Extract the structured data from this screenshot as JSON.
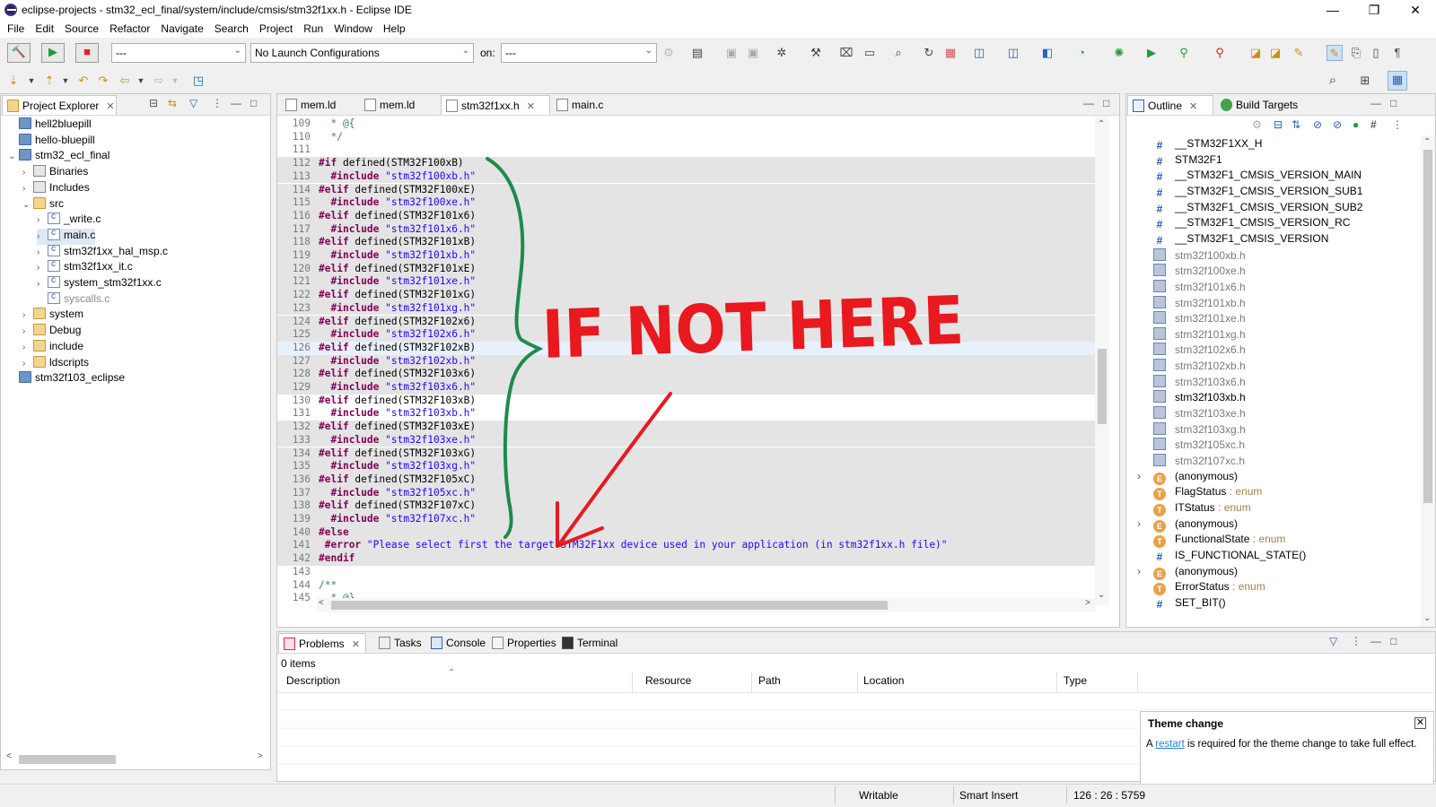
{
  "window": {
    "title": "eclipse-projects - stm32_ecl_final/system/include/cmsis/stm32f1xx.h - Eclipse IDE",
    "minimize": "—",
    "restore": "❐",
    "close": "✕"
  },
  "menu": [
    "File",
    "Edit",
    "Source",
    "Refactor",
    "Navigate",
    "Search",
    "Project",
    "Run",
    "Window",
    "Help"
  ],
  "toolbar": {
    "mode_combo": "---",
    "launch_combo": "No Launch Configurations",
    "on_label": "on:",
    "target_combo": "---"
  },
  "project_explorer": {
    "tab_label": "Project Explorer",
    "items": [
      {
        "label": "hell2bluepill",
        "icon": "project",
        "depth": 0,
        "twisty": ""
      },
      {
        "label": "hello-bluepill",
        "icon": "project",
        "depth": 0,
        "twisty": ""
      },
      {
        "label": "stm32_ecl_final",
        "icon": "project",
        "depth": 0,
        "twisty": "v"
      },
      {
        "label": "Binaries",
        "icon": "bin",
        "depth": 1,
        "twisty": ">"
      },
      {
        "label": "Includes",
        "icon": "inc",
        "depth": 1,
        "twisty": ">"
      },
      {
        "label": "src",
        "icon": "folder",
        "depth": 1,
        "twisty": "v"
      },
      {
        "label": "_write.c",
        "icon": "cfile",
        "depth": 2,
        "twisty": ">"
      },
      {
        "label": "main.c",
        "icon": "cfile",
        "depth": 2,
        "twisty": ">"
      },
      {
        "label": "stm32f1xx_hal_msp.c",
        "icon": "cfile",
        "depth": 2,
        "twisty": ">"
      },
      {
        "label": "stm32f1xx_it.c",
        "icon": "cfile",
        "depth": 2,
        "twisty": ">"
      },
      {
        "label": "system_stm32f1xx.c",
        "icon": "cfile",
        "depth": 2,
        "twisty": ">"
      },
      {
        "label": "syscalls.c",
        "icon": "cfile",
        "depth": 2,
        "twisty": ""
      },
      {
        "label": "system",
        "icon": "folder",
        "depth": 1,
        "twisty": ">"
      },
      {
        "label": "Debug",
        "icon": "folder",
        "depth": 1,
        "twisty": ">"
      },
      {
        "label": "include",
        "icon": "folder",
        "depth": 1,
        "twisty": ">"
      },
      {
        "label": "ldscripts",
        "icon": "folder",
        "depth": 1,
        "twisty": ">"
      },
      {
        "label": "stm32f103_eclipse",
        "icon": "project",
        "depth": 0,
        "twisty": ""
      }
    ]
  },
  "editor": {
    "tabs": [
      "mem.ld",
      "mem.ld",
      "stm32f1xx.h",
      "main.c"
    ],
    "active_tab": 2,
    "lines": [
      {
        "n": "109",
        "text": "  * @{"
      },
      {
        "n": "110",
        "text": "  */"
      },
      {
        "n": "111",
        "text": ""
      },
      {
        "n": "112",
        "text": "#if defined(STM32F100xB)"
      },
      {
        "n": "113",
        "text": "  #include \"stm32f100xb.h\""
      },
      {
        "n": "114",
        "text": "#elif defined(STM32F100xE)"
      },
      {
        "n": "115",
        "text": "  #include \"stm32f100xe.h\""
      },
      {
        "n": "116",
        "text": "#elif defined(STM32F101x6)"
      },
      {
        "n": "117",
        "text": "  #include \"stm32f101x6.h\""
      },
      {
        "n": "118",
        "text": "#elif defined(STM32F101xB)"
      },
      {
        "n": "119",
        "text": "  #include \"stm32f101xb.h\""
      },
      {
        "n": "120",
        "text": "#elif defined(STM32F101xE)"
      },
      {
        "n": "121",
        "text": "  #include \"stm32f101xe.h\""
      },
      {
        "n": "122",
        "text": "#elif defined(STM32F101xG)"
      },
      {
        "n": "123",
        "text": "  #include \"stm32f101xg.h\""
      },
      {
        "n": "124",
        "text": "#elif defined(STM32F102x6)"
      },
      {
        "n": "125",
        "text": "  #include \"stm32f102x6.h\""
      },
      {
        "n": "126",
        "text": "#elif defined(STM32F102xB)"
      },
      {
        "n": "127",
        "text": "  #include \"stm32f102xb.h\""
      },
      {
        "n": "128",
        "text": "#elif defined(STM32F103x6)"
      },
      {
        "n": "129",
        "text": "  #include \"stm32f103x6.h\""
      },
      {
        "n": "130",
        "text": "#elif defined(STM32F103xB)"
      },
      {
        "n": "131",
        "text": "  #include \"stm32f103xb.h\""
      },
      {
        "n": "132",
        "text": "#elif defined(STM32F103xE)"
      },
      {
        "n": "133",
        "text": "  #include \"stm32f103xe.h\""
      },
      {
        "n": "134",
        "text": "#elif defined(STM32F103xG)"
      },
      {
        "n": "135",
        "text": "  #include \"stm32f103xg.h\""
      },
      {
        "n": "136",
        "text": "#elif defined(STM32F105xC)"
      },
      {
        "n": "137",
        "text": "  #include \"stm32f105xc.h\""
      },
      {
        "n": "138",
        "text": "#elif defined(STM32F107xC)"
      },
      {
        "n": "139",
        "text": "  #include \"stm32f107xc.h\""
      },
      {
        "n": "140",
        "text": "#else"
      },
      {
        "n": "141",
        "text": " #error \"Please select first the target STM32F1xx device used in your application (in stm32f1xx.h file)\""
      },
      {
        "n": "142",
        "text": "#endif"
      },
      {
        "n": "143",
        "text": ""
      },
      {
        "n": "144",
        "text": "/**"
      },
      {
        "n": "145",
        "text": "  * @}"
      }
    ],
    "annotation": {
      "text": "IF NOT HERE",
      "text_color": "#e8191f",
      "brace_color": "#1f8a4c",
      "arrow_color": "#e8191f"
    }
  },
  "outline": {
    "tabs": [
      "Outline",
      "Build Targets"
    ],
    "items": [
      {
        "label": "__STM32F1XX_H",
        "icon": "hash",
        "dim": false,
        "type": ""
      },
      {
        "label": "STM32F1",
        "icon": "hash",
        "dim": false,
        "type": ""
      },
      {
        "label": "__STM32F1_CMSIS_VERSION_MAIN",
        "icon": "hash",
        "dim": false,
        "type": ""
      },
      {
        "label": "__STM32F1_CMSIS_VERSION_SUB1",
        "icon": "hash",
        "dim": false,
        "type": ""
      },
      {
        "label": "__STM32F1_CMSIS_VERSION_SUB2",
        "icon": "hash",
        "dim": false,
        "type": ""
      },
      {
        "label": "__STM32F1_CMSIS_VERSION_RC",
        "icon": "hash",
        "dim": false,
        "type": ""
      },
      {
        "label": "__STM32F1_CMSIS_VERSION",
        "icon": "hash",
        "dim": false,
        "type": ""
      },
      {
        "label": "stm32f100xb.h",
        "icon": "inc",
        "dim": true,
        "type": ""
      },
      {
        "label": "stm32f100xe.h",
        "icon": "inc",
        "dim": true,
        "type": ""
      },
      {
        "label": "stm32f101x6.h",
        "icon": "inc",
        "dim": true,
        "type": ""
      },
      {
        "label": "stm32f101xb.h",
        "icon": "inc",
        "dim": true,
        "type": ""
      },
      {
        "label": "stm32f101xe.h",
        "icon": "inc",
        "dim": true,
        "type": ""
      },
      {
        "label": "stm32f101xg.h",
        "icon": "inc",
        "dim": true,
        "type": ""
      },
      {
        "label": "stm32f102x6.h",
        "icon": "inc",
        "dim": true,
        "type": ""
      },
      {
        "label": "stm32f102xb.h",
        "icon": "inc",
        "dim": true,
        "type": ""
      },
      {
        "label": "stm32f103x6.h",
        "icon": "inc",
        "dim": true,
        "type": ""
      },
      {
        "label": "stm32f103xb.h",
        "icon": "inc",
        "dim": false,
        "type": ""
      },
      {
        "label": "stm32f103xe.h",
        "icon": "inc",
        "dim": true,
        "type": ""
      },
      {
        "label": "stm32f103xg.h",
        "icon": "inc",
        "dim": true,
        "type": ""
      },
      {
        "label": "stm32f105xc.h",
        "icon": "inc",
        "dim": true,
        "type": ""
      },
      {
        "label": "stm32f107xc.h",
        "icon": "inc",
        "dim": true,
        "type": ""
      },
      {
        "label": "(anonymous)",
        "icon": "enum",
        "dim": false,
        "type": "",
        "twisty": true
      },
      {
        "label": "FlagStatus",
        "icon": "type",
        "dim": false,
        "type": " : enum"
      },
      {
        "label": "ITStatus",
        "icon": "type",
        "dim": false,
        "type": " : enum"
      },
      {
        "label": "(anonymous)",
        "icon": "enum",
        "dim": false,
        "type": "",
        "twisty": true
      },
      {
        "label": "FunctionalState",
        "icon": "type",
        "dim": false,
        "type": " : enum"
      },
      {
        "label": "IS_FUNCTIONAL_STATE()",
        "icon": "hash",
        "dim": false,
        "type": ""
      },
      {
        "label": "(anonymous)",
        "icon": "enum",
        "dim": false,
        "type": "",
        "twisty": true
      },
      {
        "label": "ErrorStatus",
        "icon": "type",
        "dim": false,
        "type": " : enum"
      },
      {
        "label": "SET_BIT()",
        "icon": "hash",
        "dim": false,
        "type": ""
      }
    ]
  },
  "bottom": {
    "tabs": [
      "Problems",
      "Tasks",
      "Console",
      "Properties",
      "Terminal"
    ],
    "count": "0 items",
    "columns": [
      "Description",
      "Resource",
      "Path",
      "Location",
      "Type"
    ]
  },
  "popup": {
    "title": "Theme change",
    "prefix": "A ",
    "link": "restart",
    "suffix": " is required for the theme change to take full effect."
  },
  "status": {
    "writable": "Writable",
    "insert_mode": "Smart Insert",
    "position": "126 : 26 : 5759"
  }
}
